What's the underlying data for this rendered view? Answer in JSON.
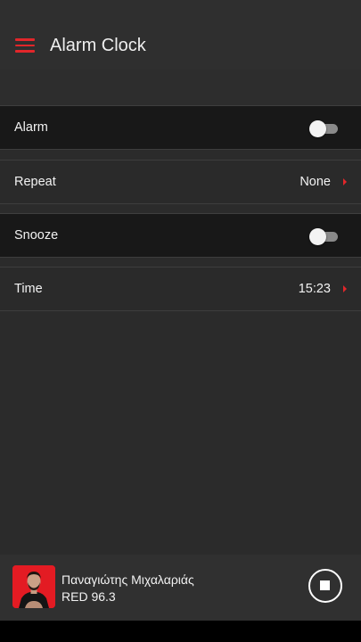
{
  "header": {
    "menu_icon": "menu-icon",
    "title": "Alarm Clock",
    "accent_color": "#e2262a"
  },
  "settings": [
    {
      "label": "Alarm",
      "type": "toggle",
      "enabled": false
    },
    {
      "label": "Repeat",
      "type": "select",
      "value": "None"
    },
    {
      "label": "Snooze",
      "type": "toggle",
      "enabled": false
    },
    {
      "label": "Time",
      "type": "select",
      "value": "15:23"
    }
  ],
  "player": {
    "artist": "Παναγιώτης Μιχαλαριάς",
    "station": "RED 96.3",
    "art_color": "#e31b23",
    "control_icon": "stop-icon"
  }
}
